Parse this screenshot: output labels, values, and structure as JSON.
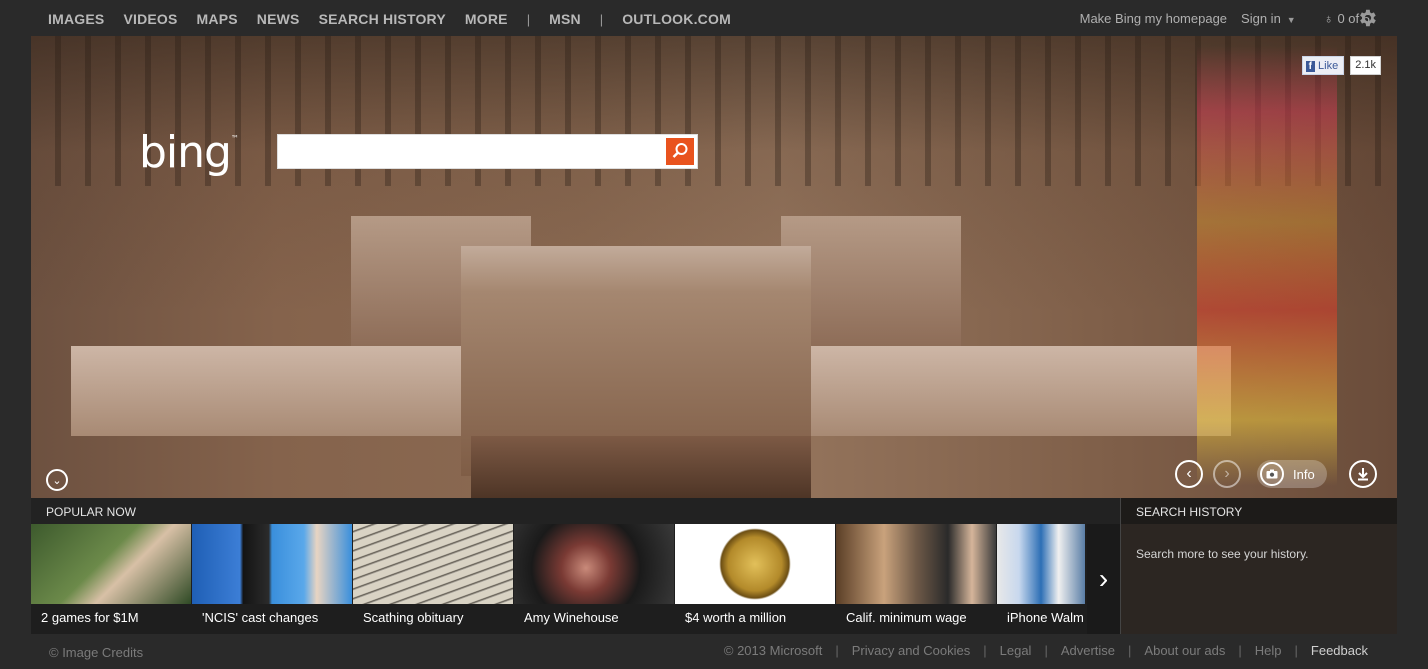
{
  "nav": {
    "items": [
      "IMAGES",
      "VIDEOS",
      "MAPS",
      "NEWS",
      "SEARCH HISTORY",
      "MORE"
    ],
    "separator": "|",
    "extra": [
      "MSN",
      "OUTLOOK.COM"
    ]
  },
  "account": {
    "homepage": "Make Bing my homepage",
    "signin": "Sign in",
    "rewards": "0 of 5"
  },
  "brand": {
    "logo": "bing",
    "tm": "™"
  },
  "search": {
    "value": "",
    "placeholder": ""
  },
  "facebook": {
    "like": "Like",
    "count": "2.1k"
  },
  "hero_controls": {
    "info": "Info"
  },
  "popular": {
    "header": "POPULAR NOW",
    "tiles": [
      {
        "caption": "2 games for $1M"
      },
      {
        "caption": "'NCIS' cast changes"
      },
      {
        "caption": "Scathing obituary"
      },
      {
        "caption": "Amy Winehouse"
      },
      {
        "caption": "$4 worth a million"
      },
      {
        "caption": "Calif. minimum wage"
      },
      {
        "caption": "iPhone Walm"
      }
    ]
  },
  "history": {
    "header": "SEARCH HISTORY",
    "text": "Search more to see your history."
  },
  "footer": {
    "credits": "© Image Credits",
    "copyright": "© 2013 Microsoft",
    "links": [
      "Privacy and Cookies",
      "Legal",
      "Advertise",
      "About our ads",
      "Help"
    ],
    "feedback": "Feedback"
  }
}
